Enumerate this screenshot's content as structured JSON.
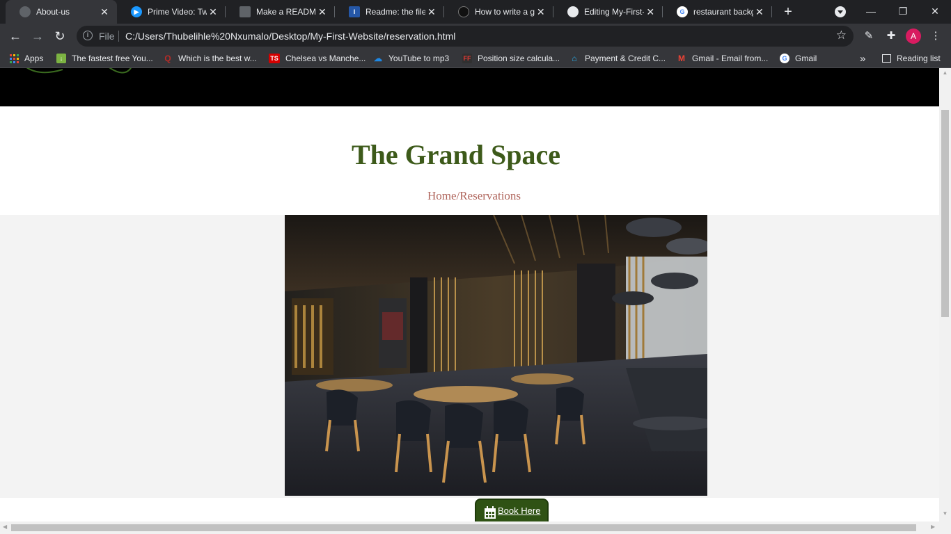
{
  "browser": {
    "tabs": [
      {
        "title": "About-us",
        "favicon": "globe-icon",
        "favicon_color": "#5f6368",
        "active": true
      },
      {
        "title": "Prime Video: Two",
        "favicon": "prime-video-icon",
        "favicon_color": "#1a98ff",
        "active": false
      },
      {
        "title": "Make a README",
        "favicon": "document-icon",
        "favicon_color": "#5f6368",
        "active": false
      },
      {
        "title": "Readme: the file t",
        "favicon": "indeed-icon",
        "favicon_color": "#2557a7",
        "active": false
      },
      {
        "title": "How to write a go",
        "favicon": "cat-icon",
        "favicon_color": "#202124",
        "active": false
      },
      {
        "title": "Editing My-First-W",
        "favicon": "github-icon",
        "favicon_color": "#ffffff",
        "active": false
      },
      {
        "title": "restaurant backgr",
        "favicon": "google-icon",
        "favicon_color": "#4285f4",
        "active": false
      }
    ],
    "close_glyph": "✕",
    "new_tab_glyph": "+",
    "address": {
      "scheme_label": "File",
      "url": "C:/Users/Thubelihle%20Nxumalo/Desktop/My-First-Website/reservation.html"
    },
    "profile_initial": "A",
    "bookmarks": [
      {
        "label": "Apps",
        "icon": "apps-grid-icon"
      },
      {
        "label": "The fastest free You...",
        "icon": "download-arrow-icon",
        "color": "#7cb342"
      },
      {
        "label": "Which is the best w...",
        "icon": "quora-icon",
        "color": "#b92b27"
      },
      {
        "label": "Chelsea vs Manche...",
        "icon": "ts-icon",
        "color": "#d50000"
      },
      {
        "label": "YouTube to mp3",
        "icon": "cloud-download-icon",
        "color": "#1e88e5"
      },
      {
        "label": "Position size calcula...",
        "icon": "ff-icon",
        "color": "#303030"
      },
      {
        "label": "Payment & Credit C...",
        "icon": "payment-icon",
        "color": "#29b6f6"
      },
      {
        "label": "Gmail - Email from...",
        "icon": "gmail-icon",
        "color": "#ea4335"
      },
      {
        "label": "Gmail",
        "icon": "google-icon",
        "color": "#4285f4"
      }
    ],
    "overflow_glyph": "»",
    "reading_list": "Reading list"
  },
  "page": {
    "site_title": "The Grand Space",
    "breadcrumb": "Home/Reservations",
    "book_button": "Book Here",
    "colors": {
      "title": "#3d5a1a",
      "breadcrumb": "#b0665d",
      "button_bg": "#2f5214",
      "header_bg": "#000000"
    }
  }
}
